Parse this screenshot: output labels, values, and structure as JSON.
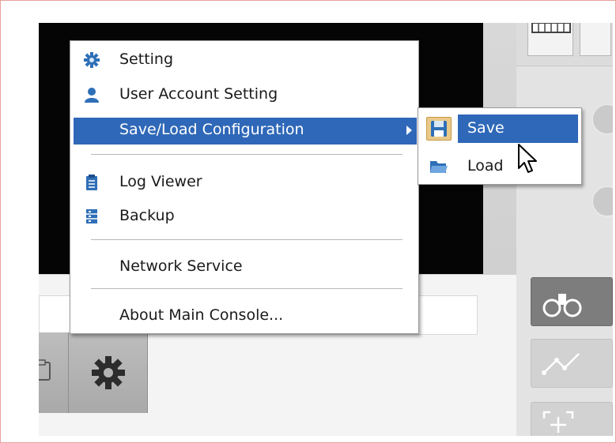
{
  "menu": {
    "items": [
      {
        "label": "Setting",
        "icon": "gear-icon"
      },
      {
        "label": "User Account Setting",
        "icon": "user-icon"
      },
      {
        "label": "Save/Load Configuration",
        "icon": "",
        "selected": true,
        "has_submenu": true
      },
      {
        "label": "Log Viewer",
        "icon": "clipboard-icon"
      },
      {
        "label": "Backup",
        "icon": "backup-icon"
      },
      {
        "label": "Network Service",
        "icon": ""
      },
      {
        "label": "About Main Console...",
        "icon": ""
      }
    ]
  },
  "submenu": {
    "items": [
      {
        "label": "Save",
        "icon": "floppy-disk-icon",
        "selected": true
      },
      {
        "label": "Load",
        "icon": "folder-open-icon"
      }
    ]
  },
  "colors": {
    "selection": "#2f68b8",
    "video_background": "#050505",
    "panel": "#e3e3e3"
  },
  "toolbar": {
    "settings_button_icon": "gear-icon",
    "right_tools": [
      "binoculars-icon",
      "path-icon",
      "zoom-area-icon"
    ]
  }
}
